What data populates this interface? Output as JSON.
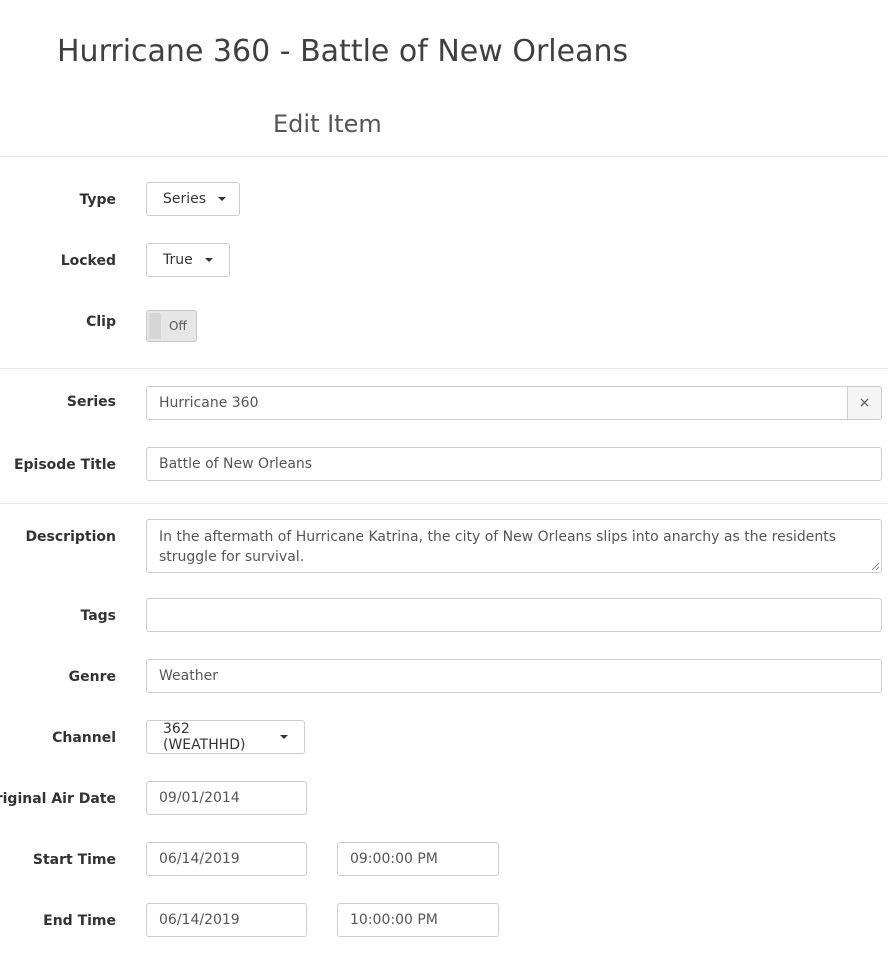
{
  "page": {
    "title": "Hurricane 360 - Battle of New Orleans"
  },
  "modal": {
    "title": "Edit Item"
  },
  "type": {
    "label": "Type",
    "value": "Series"
  },
  "locked": {
    "label": "Locked",
    "value": "True"
  },
  "clip": {
    "label": "Clip",
    "value": "Off"
  },
  "series": {
    "label": "Series",
    "value": "Hurricane 360",
    "clear": "×"
  },
  "episode_title": {
    "label": "Episode Title",
    "value": "Battle of New Orleans"
  },
  "description": {
    "label": "Description",
    "value": "In the aftermath of Hurricane Katrina, the city of New Orleans slips into anarchy as the residents struggle for survival."
  },
  "tags": {
    "label": "Tags",
    "value": ""
  },
  "genre": {
    "label": "Genre",
    "value": "Weather"
  },
  "channel": {
    "label": "Channel",
    "value": "362 (WEATHHD)"
  },
  "original_air_date": {
    "label": "Original Air Date",
    "value": "09/01/2014"
  },
  "start_time": {
    "label": "Start Time",
    "date": "06/14/2019",
    "time": "09:00:00 PM"
  },
  "end_time": {
    "label": "End Time",
    "date": "06/14/2019",
    "time": "10:00:00 PM"
  }
}
